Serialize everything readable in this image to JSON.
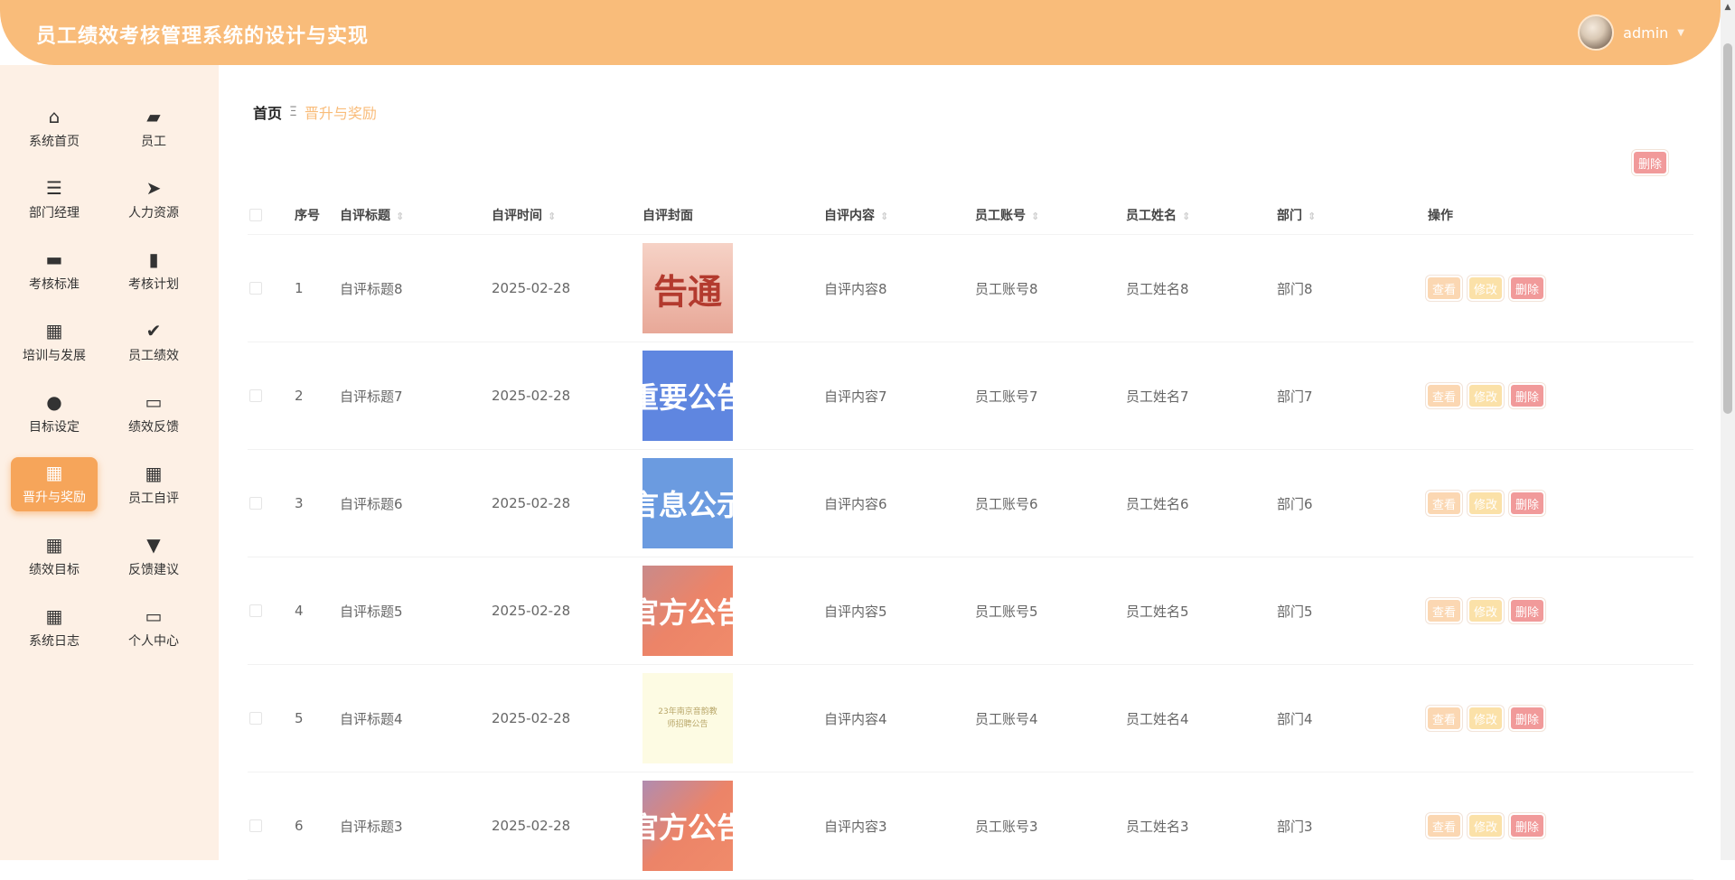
{
  "header": {
    "title": "员工绩效考核管理系统的设计与实现",
    "username": "admin"
  },
  "sidebar": {
    "items": [
      {
        "label": "系统首页",
        "icon": "home-icon",
        "glyph": "⌂"
      },
      {
        "label": "员工",
        "icon": "wallet-icon",
        "glyph": "▰"
      },
      {
        "label": "部门经理",
        "icon": "list-icon",
        "glyph": "☰"
      },
      {
        "label": "人力资源",
        "icon": "send-icon",
        "glyph": "➤"
      },
      {
        "label": "考核标准",
        "icon": "inbox-icon",
        "glyph": "▬"
      },
      {
        "label": "考核计划",
        "icon": "bar-chart-icon",
        "glyph": "▮"
      },
      {
        "label": "培训与发展",
        "icon": "grid-icon",
        "glyph": "▦"
      },
      {
        "label": "员工绩效",
        "icon": "clipboard-check-icon",
        "glyph": "✔"
      },
      {
        "label": "目标设定",
        "icon": "user-icon",
        "glyph": "●"
      },
      {
        "label": "绩效反馈",
        "icon": "monitor-icon",
        "glyph": "▭"
      },
      {
        "label": "晋升与奖励",
        "icon": "grid-icon",
        "glyph": "▦",
        "active": true
      },
      {
        "label": "员工自评",
        "icon": "grid-icon",
        "glyph": "▦"
      },
      {
        "label": "绩效目标",
        "icon": "grid-icon",
        "glyph": "▦"
      },
      {
        "label": "反馈建议",
        "icon": "brush-icon",
        "glyph": "▼"
      },
      {
        "label": "系统日志",
        "icon": "grid-icon",
        "glyph": "▦"
      },
      {
        "label": "个人中心",
        "icon": "card-icon",
        "glyph": "▭"
      }
    ]
  },
  "breadcrumb": {
    "home": "首页",
    "separator": "Ξ",
    "current": "晋升与奖励"
  },
  "toolbar": {
    "delete_label": "删除"
  },
  "table": {
    "headers": {
      "no": "序号",
      "title": "自评标题",
      "time": "自评时间",
      "cover": "自评封面",
      "content": "自评内容",
      "account": "员工账号",
      "name": "员工姓名",
      "dept": "部门",
      "ops": "操作"
    },
    "actions": {
      "view": "查看",
      "edit": "修改",
      "delete": "删除"
    },
    "rows": [
      {
        "no": "1",
        "title": "自评标题8",
        "time": "2025-02-28",
        "cover_text": "告通",
        "content": "自评内容8",
        "account": "员工账号8",
        "name": "员工姓名8",
        "dept": "部门8"
      },
      {
        "no": "2",
        "title": "自评标题7",
        "time": "2025-02-28",
        "cover_text": "重要公告",
        "content": "自评内容7",
        "account": "员工账号7",
        "name": "员工姓名7",
        "dept": "部门7"
      },
      {
        "no": "3",
        "title": "自评标题6",
        "time": "2025-02-28",
        "cover_text": "言息公示",
        "content": "自评内容6",
        "account": "员工账号6",
        "name": "员工姓名6",
        "dept": "部门6"
      },
      {
        "no": "4",
        "title": "自评标题5",
        "time": "2025-02-28",
        "cover_text": "官方公告",
        "content": "自评内容5",
        "account": "员工账号5",
        "name": "员工姓名5",
        "dept": "部门5"
      },
      {
        "no": "5",
        "title": "自评标题4",
        "time": "2025-02-28",
        "cover_text": "23年南京音韵教师招聘公告",
        "content": "自评内容4",
        "account": "员工账号4",
        "name": "员工姓名4",
        "dept": "部门4"
      },
      {
        "no": "6",
        "title": "自评标题3",
        "time": "2025-02-28",
        "cover_text": "官方公告",
        "content": "自评内容3",
        "account": "员工账号3",
        "name": "员工姓名3",
        "dept": "部门3"
      }
    ]
  },
  "colors": {
    "accent": "#f9bc7a",
    "active_menu": "#f6a55a",
    "delete": "#f19a9a",
    "sidebar_bg": "#fdf0e5"
  }
}
